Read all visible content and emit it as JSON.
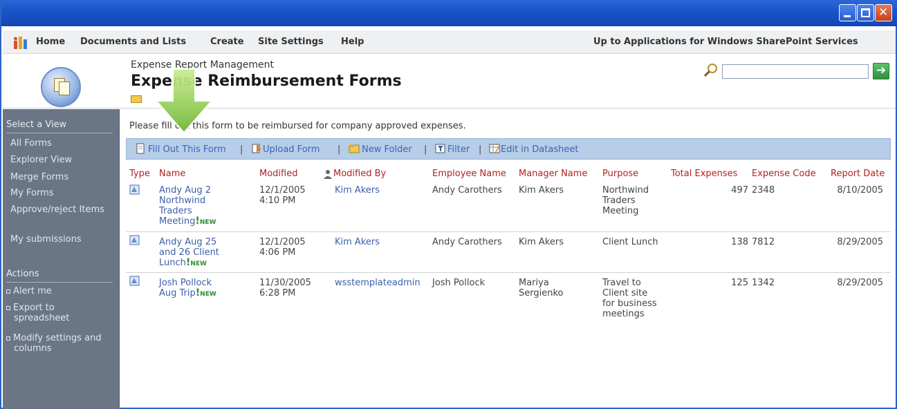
{
  "window": {
    "controls": [
      "minimize",
      "maximize",
      "close"
    ]
  },
  "topnav": {
    "items": [
      "Home",
      "Documents and Lists",
      "Create",
      "Site Settings",
      "Help"
    ],
    "up_link": "Up to Applications for Windows SharePoint Services"
  },
  "header": {
    "site_title": "Expense Report Management",
    "page_title": "Expense Reimbursement Forms",
    "search_placeholder": "",
    "go_glyph": "➔"
  },
  "leftnav": {
    "select_view_heading": "Select a View",
    "views": [
      "All Forms",
      "Explorer View",
      "Merge Forms",
      "My Forms",
      "Approve/reject Items",
      "My submissions"
    ],
    "actions_heading": "Actions",
    "actions": [
      "Alert me",
      "Export to spreadsheet",
      "Modify settings and columns"
    ]
  },
  "description": "Please fill out this form to be reimbursed for company approved expenses.",
  "toolbar": {
    "fill_out": "Fill Out This Form",
    "upload": "Upload Form",
    "new_folder": "New Folder",
    "filter": "Filter",
    "edit_datasheet": "Edit in Datasheet",
    "separator": "|"
  },
  "table": {
    "columns": [
      "Type",
      "Name",
      "Modified",
      "Modified By",
      "Employee Name",
      "Manager Name",
      "Purpose",
      "Total Expenses",
      "Expense Code",
      "Report Date"
    ],
    "new_label": "NEW",
    "rows": [
      {
        "name_lines": [
          "Andy Aug 2",
          "Northwind",
          "Traders",
          "Meeting"
        ],
        "modified_lines": [
          "12/1/2005",
          "4:10 PM"
        ],
        "modified_by": "Kim Akers",
        "employee": "Andy Carothers",
        "manager_lines": [
          "Kim Akers"
        ],
        "purpose_lines": [
          "Northwind",
          "Traders",
          "Meeting"
        ],
        "total": "497",
        "code": "2348",
        "date": "8/10/2005"
      },
      {
        "name_lines": [
          "Andy Aug 25",
          "and 26 Client",
          "Lunch"
        ],
        "modified_lines": [
          "12/1/2005",
          "4:06 PM"
        ],
        "modified_by": "Kim Akers",
        "employee": "Andy Carothers",
        "manager_lines": [
          "Kim Akers"
        ],
        "purpose_lines": [
          "Client Lunch"
        ],
        "total": "138",
        "code": "7812",
        "date": "8/29/2005"
      },
      {
        "name_lines": [
          "Josh Pollock",
          "Aug Trip"
        ],
        "modified_lines": [
          "11/30/2005",
          "6:28 PM"
        ],
        "modified_by": "wsstemplateadmin",
        "employee": "Josh Pollock",
        "manager_lines": [
          "Mariya",
          "Sergienko"
        ],
        "purpose_lines": [
          "Travel to",
          "Client site",
          "for business",
          "meetings"
        ],
        "total": "125",
        "code": "1342",
        "date": "8/29/2005"
      }
    ]
  },
  "colors": {
    "titlebar": "#1a55c8",
    "toolbar": "#b7cde8",
    "leftnav": "#6a7686",
    "column_header": "#b02222",
    "link": "#3b5fa8",
    "new_badge": "#2e8b2e",
    "arrow": "#8fcf4a"
  },
  "overlay": {
    "arrow_icon": "green-down-arrow"
  }
}
